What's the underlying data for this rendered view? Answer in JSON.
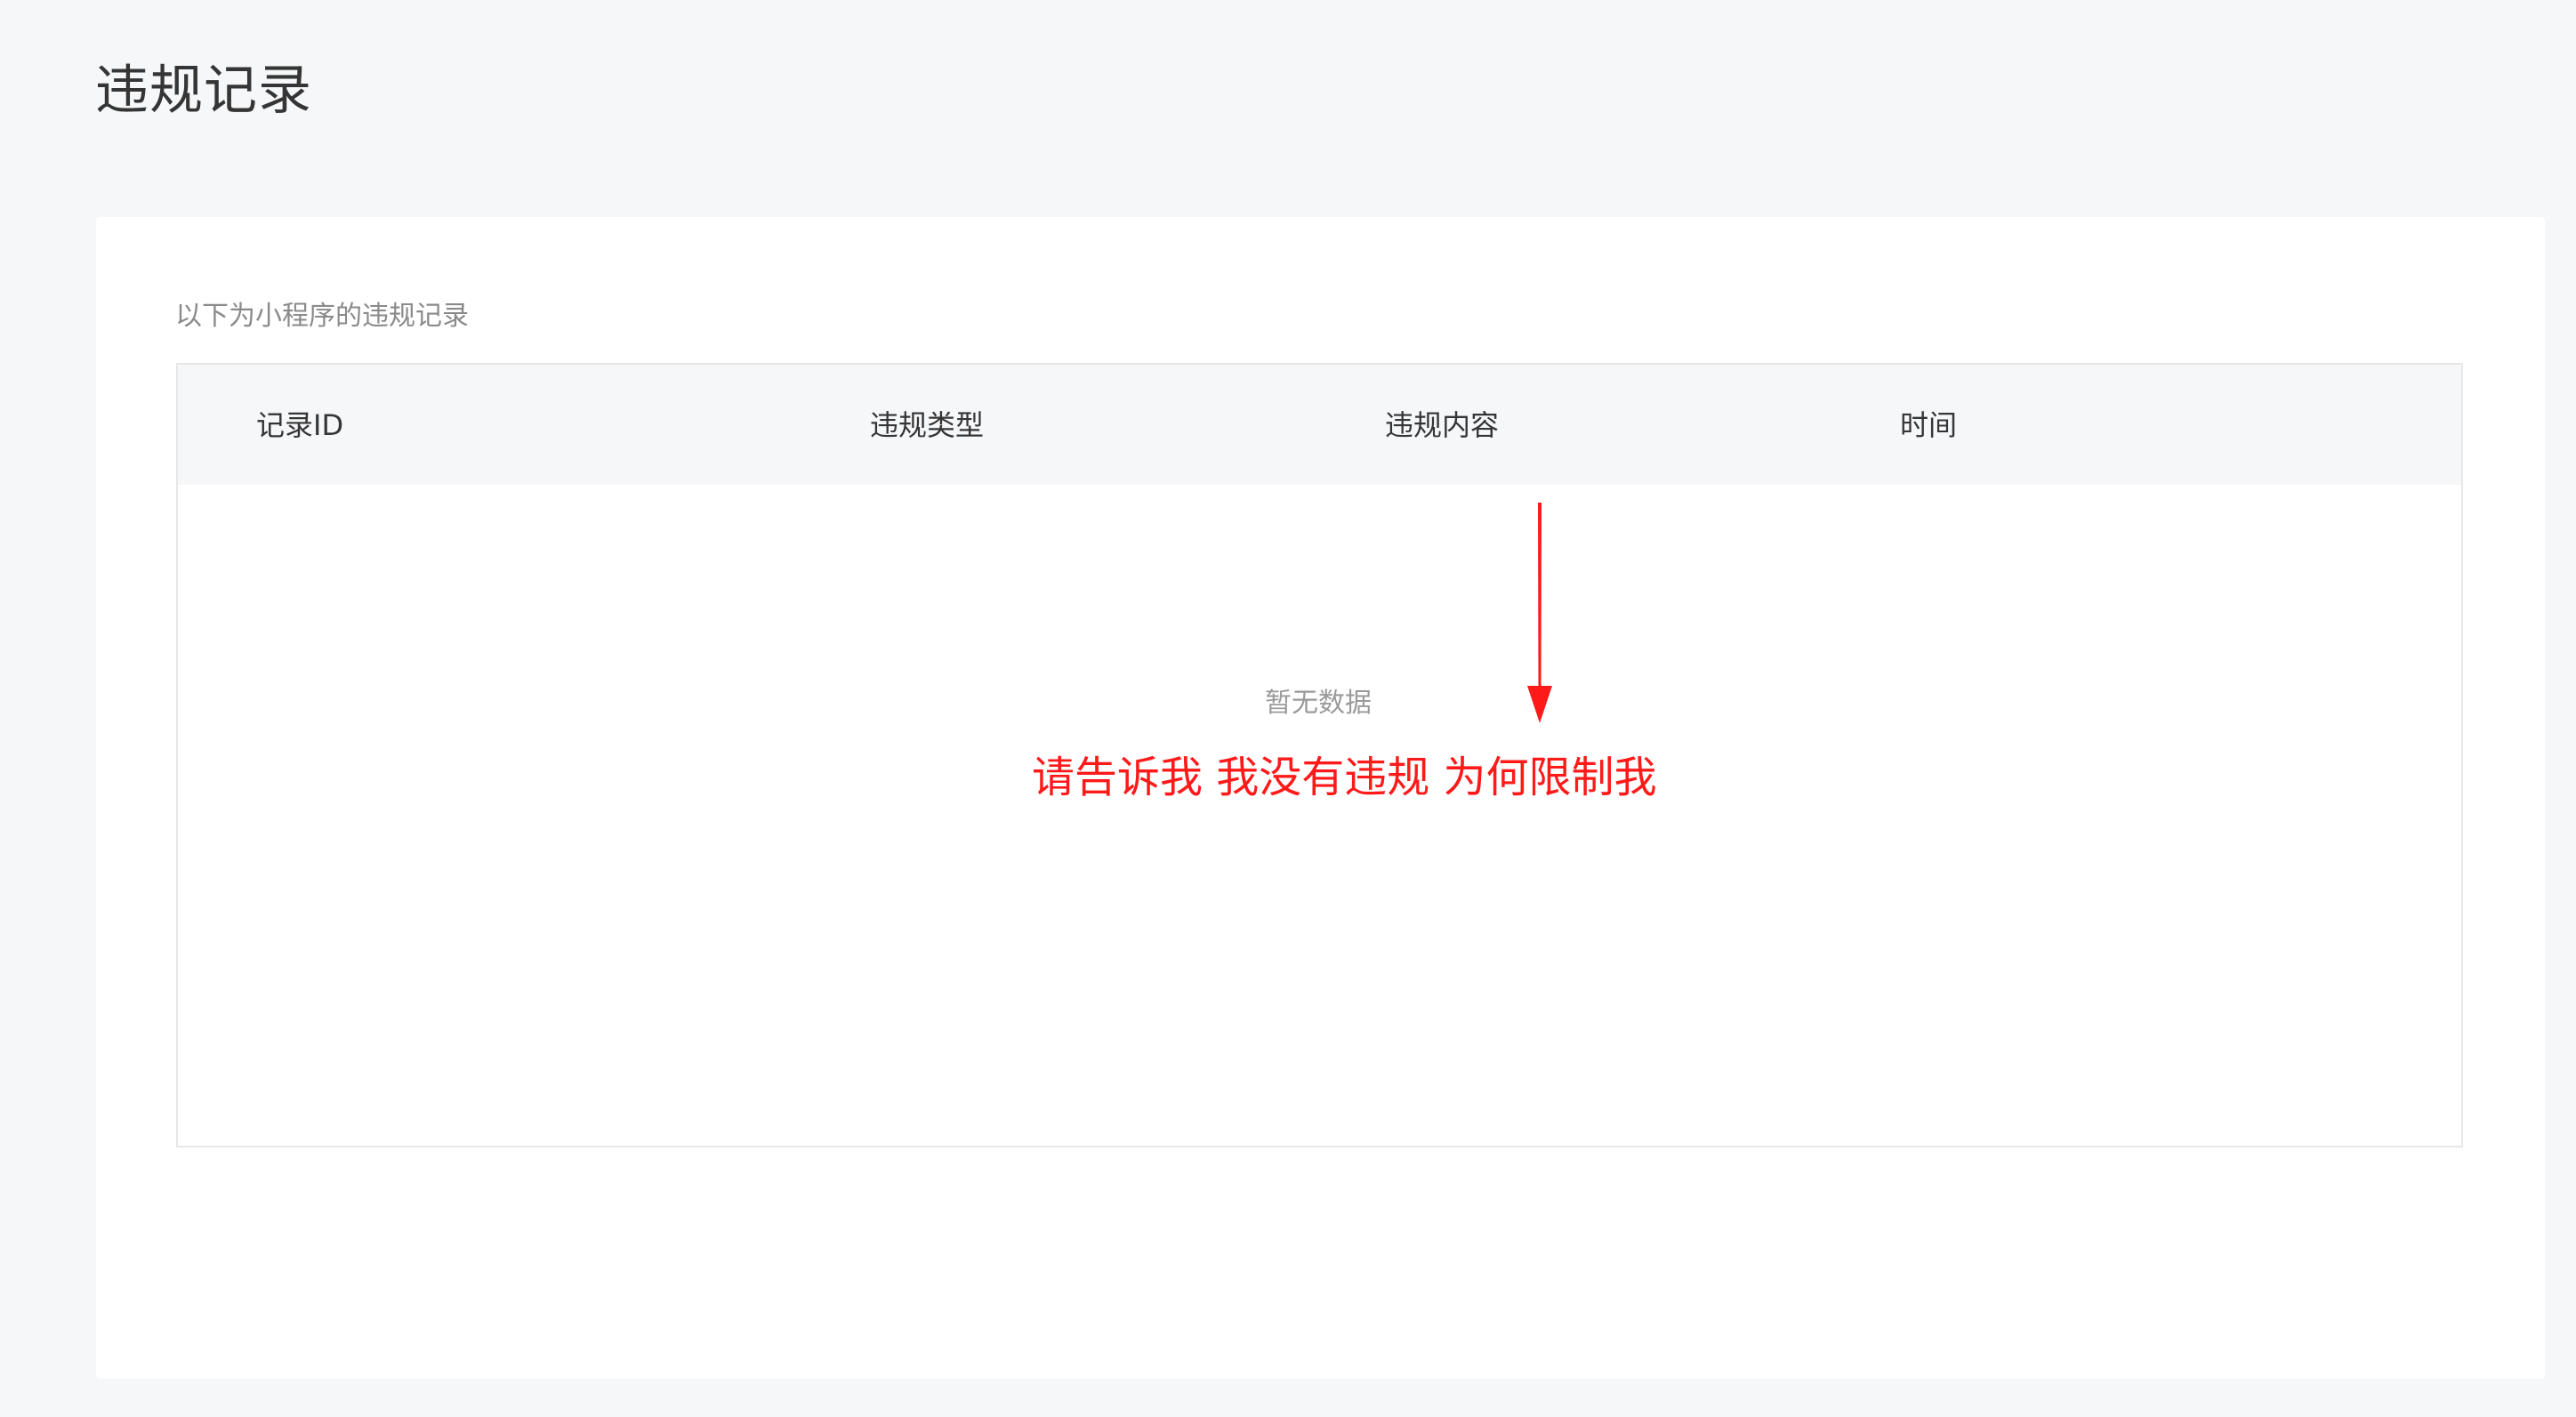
{
  "page": {
    "title": "违规记录"
  },
  "card": {
    "caption": "以下为小程序的违规记录",
    "table": {
      "columns": [
        "记录ID",
        "违规类型",
        "违规内容",
        "时间"
      ],
      "rows": [],
      "empty_text": "暂无数据"
    },
    "annotation": {
      "text": "请告诉我 我没有违规 为何限制我",
      "color": "#ff1a1a",
      "icon": "red-down-arrow"
    }
  },
  "colors": {
    "background": "#f6f7f9",
    "card": "#ffffff",
    "header_row": "#f6f7f9",
    "border": "#e7e7e7",
    "annotation": "#ff1a1a"
  }
}
